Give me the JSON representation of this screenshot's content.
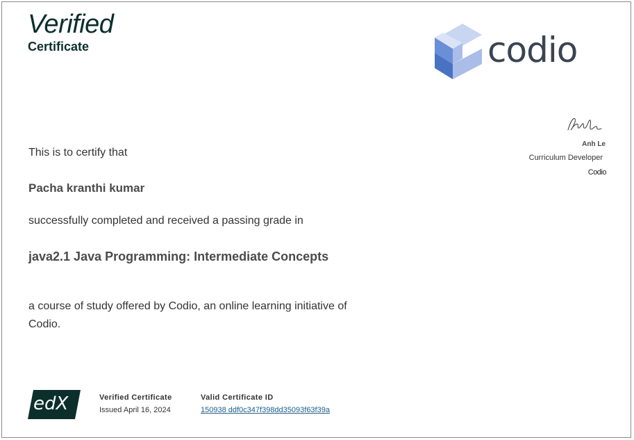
{
  "header": {
    "title": "Verified",
    "subtitle": "Certificate"
  },
  "brand": {
    "logo_text": "codio",
    "logo_colors": [
      "#a9bde8",
      "#6b8fd6",
      "#4a72c4",
      "#c9d6f2"
    ]
  },
  "signatory": {
    "name": "Anh Le",
    "role": "Curriculum Developer",
    "org": "Codio"
  },
  "certificate": {
    "intro": "This is to certify that",
    "recipient": "Pacha kranthi kumar",
    "completion": "successfully completed and received a passing grade in",
    "course": "java2.1 Java Programming: Intermediate Concepts",
    "offered": "a course of study offered by Codio, an online learning initiative of Codio."
  },
  "footer": {
    "edx_logo": "edX",
    "type_label": "Verified Certificate",
    "issued": "Issued April 16, 2024",
    "id_label": "Valid Certificate ID",
    "id_value": "150938 ddf0c347f398dd35093f63f39a"
  }
}
